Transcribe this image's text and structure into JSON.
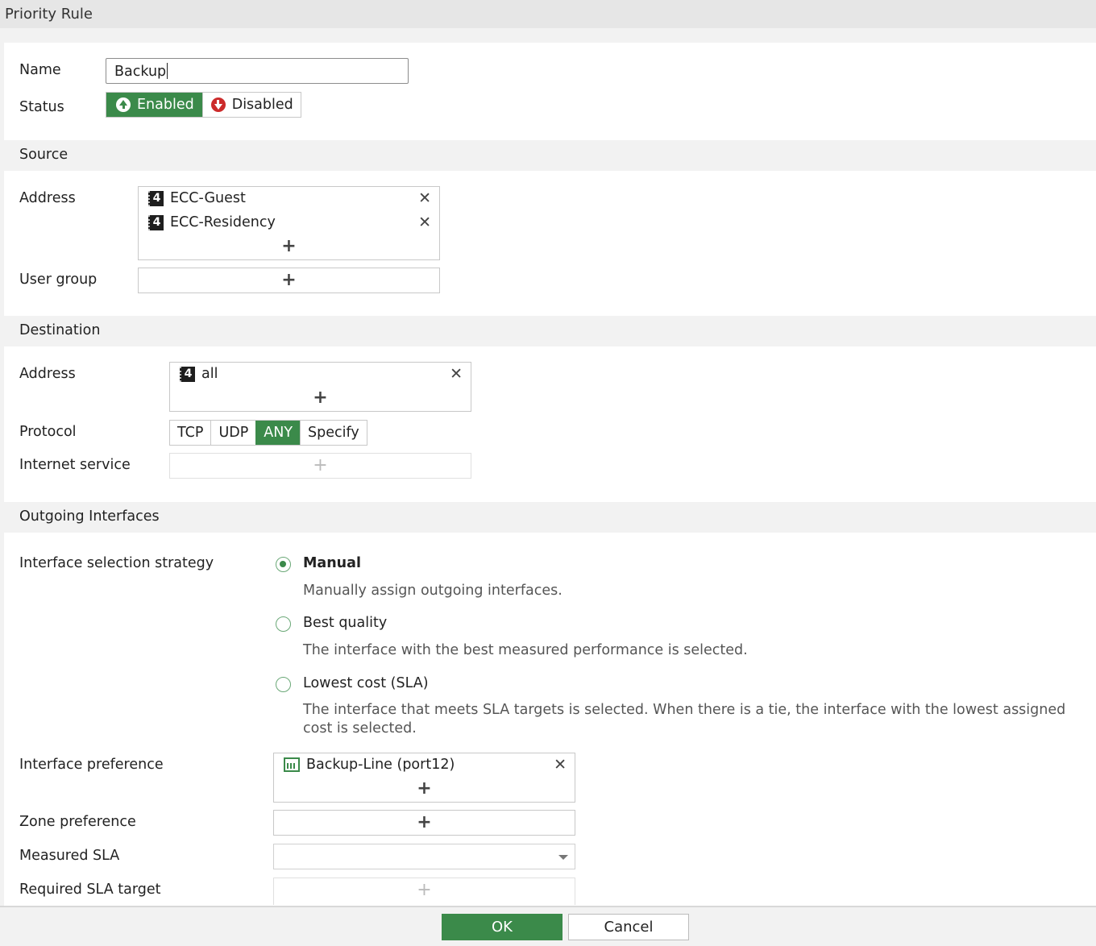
{
  "window": {
    "title": "Priority Rule"
  },
  "general": {
    "name_label": "Name",
    "name_value": "Backup",
    "status_label": "Status",
    "status_enabled": "Enabled",
    "status_disabled": "Disabled",
    "status_selected": "Enabled"
  },
  "source": {
    "section_title": "Source",
    "address_label": "Address",
    "addresses": [
      "ECC-Guest",
      "ECC-Residency"
    ],
    "user_group_label": "User group"
  },
  "destination": {
    "section_title": "Destination",
    "address_label": "Address",
    "addresses": [
      "all"
    ],
    "protocol_label": "Protocol",
    "protocols": [
      "TCP",
      "UDP",
      "ANY",
      "Specify"
    ],
    "protocol_selected": "ANY",
    "internet_service_label": "Internet service"
  },
  "outgoing": {
    "section_title": "Outgoing Interfaces",
    "strategy_label": "Interface selection strategy",
    "strategies": [
      {
        "title": "Manual",
        "desc": "Manually assign outgoing interfaces.",
        "checked": true
      },
      {
        "title": "Best quality",
        "desc": "The interface with the best measured performance is selected.",
        "checked": false
      },
      {
        "title": "Lowest cost (SLA)",
        "desc": "The interface that meets SLA targets is selected. When there is a tie, the interface with the lowest assigned cost is selected.",
        "checked": false
      }
    ],
    "interface_pref_label": "Interface preference",
    "interfaces": [
      "Backup-Line (port12)"
    ],
    "zone_pref_label": "Zone preference",
    "measured_sla_label": "Measured SLA",
    "measured_sla_value": "",
    "required_sla_label": "Required SLA target"
  },
  "footer": {
    "ok_label": "OK",
    "cancel_label": "Cancel"
  },
  "icons": {
    "address": "address-object-icon",
    "interface": "port-icon",
    "remove": "close-icon",
    "add": "plus-icon",
    "enabled": "arrow-up-circle-icon",
    "disabled": "arrow-down-circle-icon"
  },
  "colors": {
    "accent": "#3b8a4a",
    "danger": "#cc2b2b",
    "section_bg": "#f2f2f2"
  }
}
